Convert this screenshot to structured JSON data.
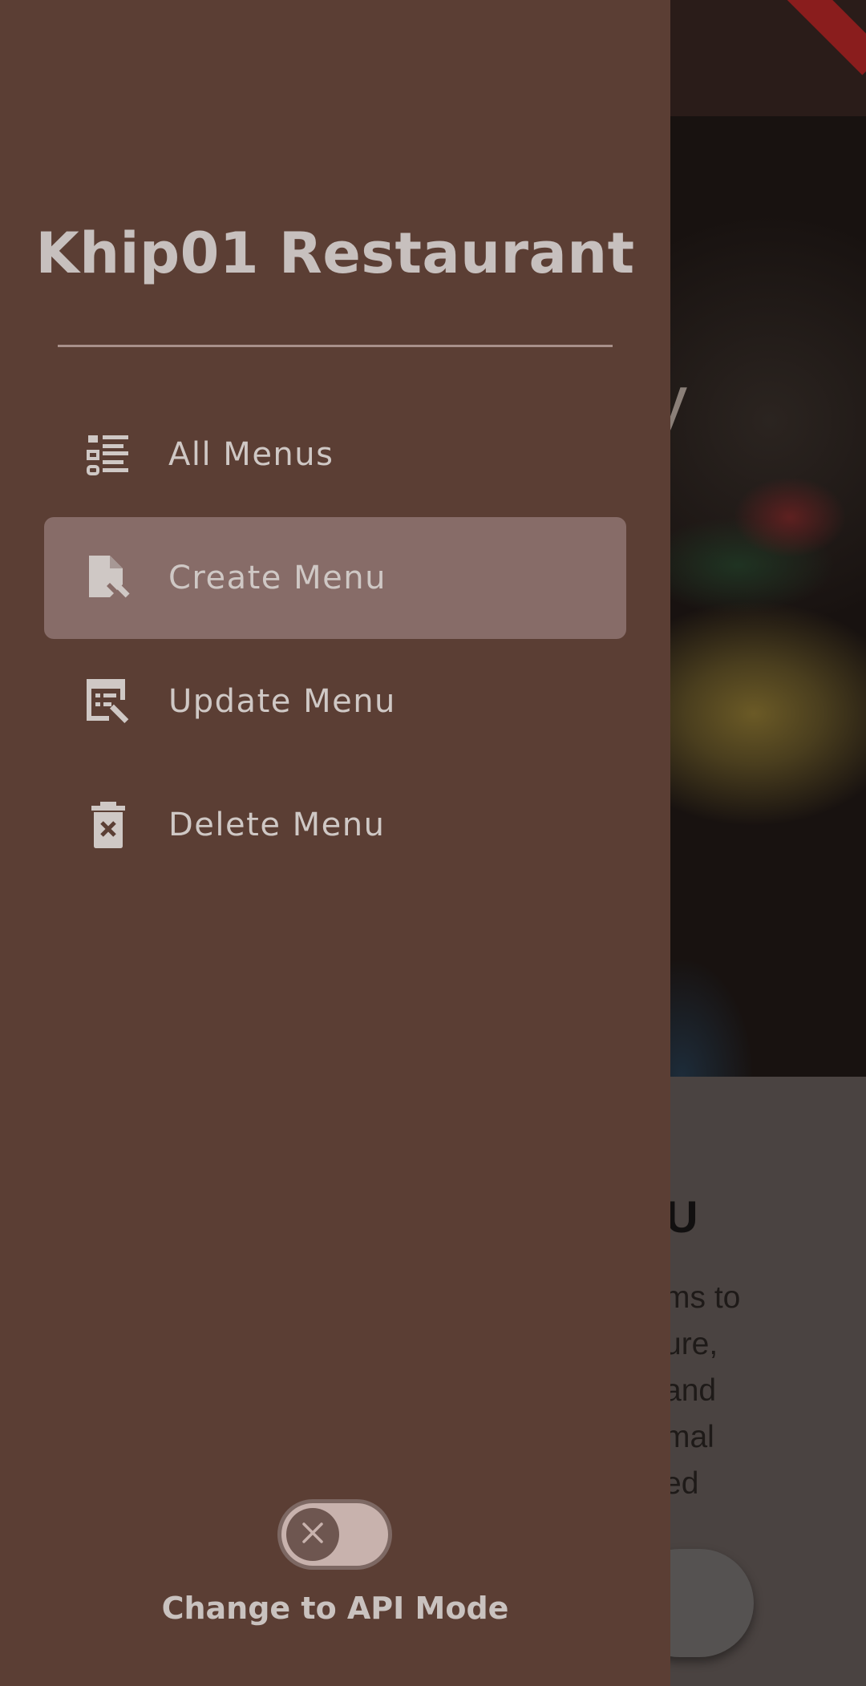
{
  "app": {
    "title": "Khip01 Restaurant",
    "background": {
      "hero_letter": "y",
      "card_title": "U",
      "card_desc": "ms to\nure,\n and\nmal\ned"
    }
  },
  "drawer": {
    "items": [
      {
        "label": "All Menus",
        "icon": "list-icon",
        "selected": false
      },
      {
        "label": "Create Menu",
        "icon": "create-document-icon",
        "selected": true
      },
      {
        "label": "Update Menu",
        "icon": "edit-document-icon",
        "selected": false
      },
      {
        "label": "Delete Menu",
        "icon": "delete-bin-icon",
        "selected": false
      }
    ],
    "mode_toggle": {
      "label": "Change to API Mode",
      "on": false
    }
  },
  "colors": {
    "drawer_bg": "#5b3e34",
    "selected_item_bg": "#876c68",
    "text": "#cfc8c5"
  }
}
